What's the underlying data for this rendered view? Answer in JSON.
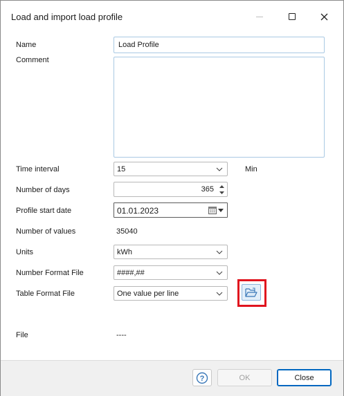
{
  "window": {
    "title": "Load and import load profile"
  },
  "form": {
    "name_label": "Name",
    "name_value": "Load Profile",
    "comment_label": "Comment",
    "comment_value": "",
    "time_interval_label": "Time interval",
    "time_interval_value": "15",
    "time_interval_unit": "Min",
    "days_label": "Number of days",
    "days_value": "365",
    "start_date_label": "Profile start date",
    "start_date_value": "01.01.2023",
    "num_values_label": "Number of values",
    "num_values_value": "35040",
    "units_label": "Units",
    "units_value": "kWh",
    "number_format_label": "Number Format File",
    "number_format_value": "####,##",
    "table_format_label": "Table Format File",
    "table_format_value": "One value per line",
    "file_label": "File",
    "file_value": "----"
  },
  "icons": {
    "open_folder": "open-folder-icon",
    "help": "help-icon",
    "calendar": "calendar-icon"
  },
  "footer": {
    "help_label": "?",
    "ok_label": "OK",
    "close_label": "Close"
  },
  "colors": {
    "highlight": "#e0141e",
    "accent": "#0067c0",
    "focus_border": "#a9c9e3"
  }
}
